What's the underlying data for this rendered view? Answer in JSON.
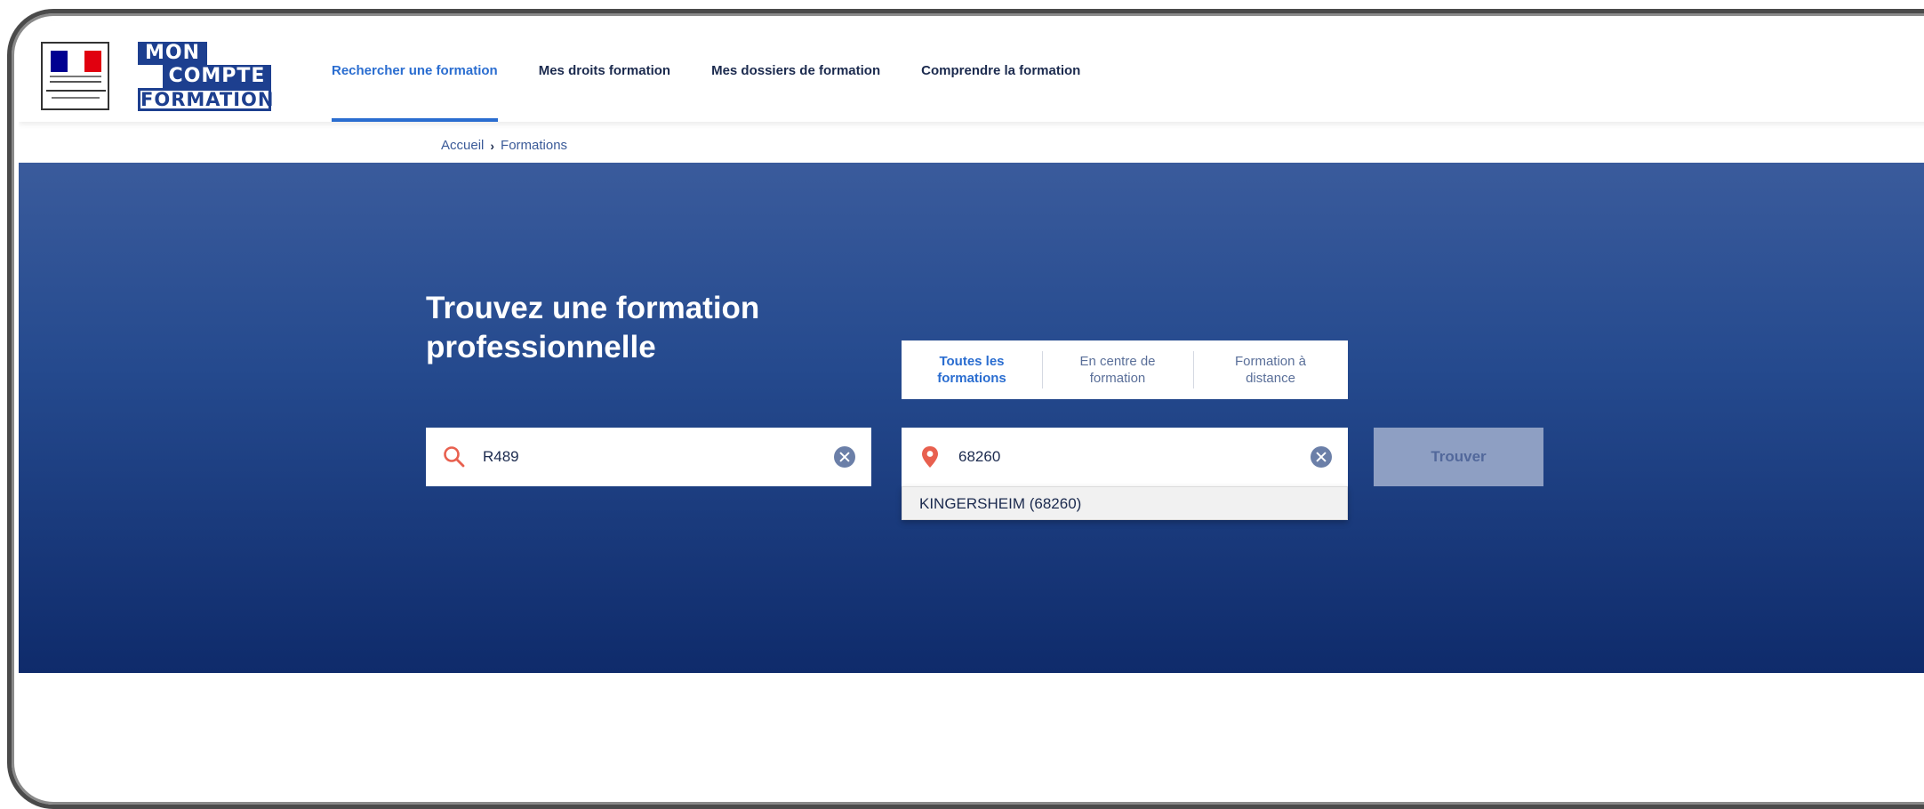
{
  "header": {
    "logo": {
      "line1": "MON",
      "line2": "COMPTE",
      "line3": "FORMATION"
    },
    "nav": [
      {
        "label": "Rechercher une formation",
        "active": true
      },
      {
        "label": "Mes droits formation",
        "active": false
      },
      {
        "label": "Mes dossiers de formation",
        "active": false
      },
      {
        "label": "Comprendre la formation",
        "active": false
      }
    ]
  },
  "breadcrumb": {
    "home": "Accueil",
    "current": "Formations"
  },
  "hero": {
    "title": "Trouvez une formation professionnelle",
    "tabs": [
      {
        "label": "Toutes les formations",
        "active": true
      },
      {
        "label": "En centre de formation",
        "active": false
      },
      {
        "label": "Formation à distance",
        "active": false
      }
    ],
    "search": {
      "value": "R489"
    },
    "location": {
      "value": "68260"
    },
    "suggestions": [
      "KINGERSHEIM (68260)"
    ],
    "submit_label": "Trouver"
  },
  "colors": {
    "brand_blue": "#1d3f8f",
    "accent_blue": "#2a6dd0",
    "hero_top": "#3a5b9c",
    "hero_bottom": "#0f2b6b",
    "pin_red": "#e8604f",
    "button_disabled": "#8e9fc3"
  },
  "icons": {
    "search": "search-icon",
    "location": "location-pin-icon",
    "clear": "clear-icon"
  }
}
